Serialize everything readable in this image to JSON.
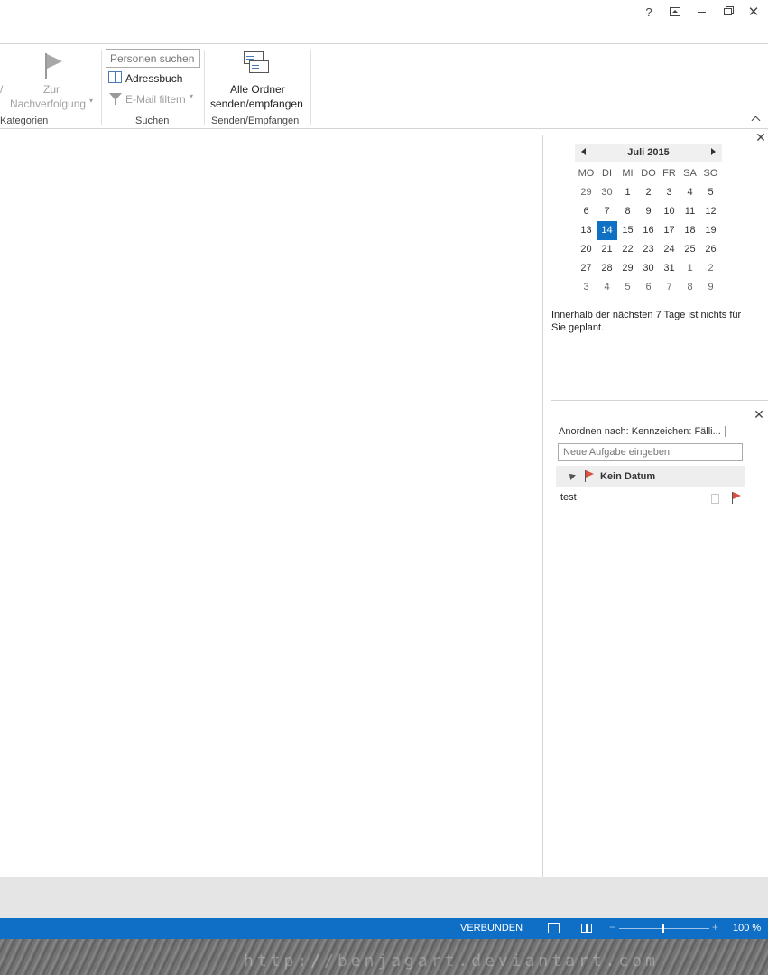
{
  "window": {
    "help": "?",
    "ribbon_display": "⊼",
    "minimize": "—",
    "restore": "🗗",
    "close": "✕"
  },
  "ribbon": {
    "partial_left_char": "/",
    "followup_label_line1": "Zur",
    "followup_label_line2": "Nachverfolgung",
    "categories_group": "Kategorien",
    "search_people_placeholder": "Personen suchen",
    "addressbook_label": "Adressbuch",
    "filter_email_label": "E-Mail filtern",
    "search_group": "Suchen",
    "sendreceive_line1": "Alle Ordner",
    "sendreceive_line2": "senden/empfangen",
    "sendreceive_group": "Senden/Empfangen",
    "collapse": "^"
  },
  "calendar": {
    "month_label": "Juli 2015",
    "weekdays": [
      "MO",
      "DI",
      "MI",
      "DO",
      "FR",
      "SA",
      "SO"
    ],
    "weeks": [
      [
        "29",
        "30",
        "1",
        "2",
        "3",
        "4",
        "5"
      ],
      [
        "6",
        "7",
        "8",
        "9",
        "10",
        "11",
        "12"
      ],
      [
        "13",
        "14",
        "15",
        "16",
        "17",
        "18",
        "19"
      ],
      [
        "20",
        "21",
        "22",
        "23",
        "24",
        "25",
        "26"
      ],
      [
        "27",
        "28",
        "29",
        "30",
        "31",
        "1",
        "2"
      ],
      [
        "3",
        "4",
        "5",
        "6",
        "7",
        "8",
        "9"
      ]
    ],
    "today": "14",
    "today_color": "#1070c4"
  },
  "appointments": {
    "notice": "Innerhalb der nächsten 7 Tage ist nichts für Sie geplant."
  },
  "tasks": {
    "sort_label": "Anordnen nach: Kennzeichen: Fälli...",
    "new_task_placeholder": "Neue Aufgabe eingeben",
    "group_label": "Kein Datum",
    "items": [
      {
        "name": "test"
      }
    ],
    "flag_color": "#d9503f"
  },
  "status": {
    "connection": "VERBUNDEN",
    "zoom": "100 %",
    "zoom_minus": "−",
    "zoom_plus": "+",
    "accent_color": "#0f6fc6"
  },
  "desktop": {
    "watermark": "http://benjagart.deviantart.com"
  }
}
